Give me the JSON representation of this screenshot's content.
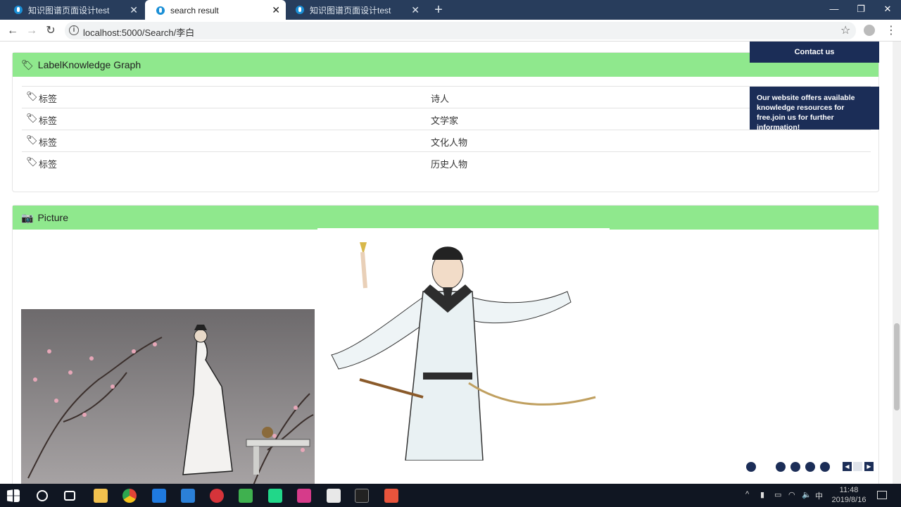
{
  "browser": {
    "tabs": [
      {
        "label": "知识图谱页面设计test"
      },
      {
        "label": "search result"
      },
      {
        "label": "知识图谱页面设计test"
      }
    ],
    "url": "localhost:5000/Search/李白"
  },
  "label_panel": {
    "title_prefix": "Label",
    "title": "Knowledge Graph",
    "rows": [
      {
        "key": "标签",
        "value": "诗人"
      },
      {
        "key": "标签",
        "value": "文学家"
      },
      {
        "key": "标签",
        "value": "文化人物"
      },
      {
        "key": "标签",
        "value": "历史人物"
      }
    ]
  },
  "picture_panel": {
    "title": "Picture"
  },
  "sidebar": {
    "contact_label": "Contact us",
    "promo_text": "Our website offers available knowledge resources for free.join us for further information!"
  },
  "taskbar": {
    "time": "11:48",
    "date": "2019/8/16",
    "ime": "中"
  }
}
